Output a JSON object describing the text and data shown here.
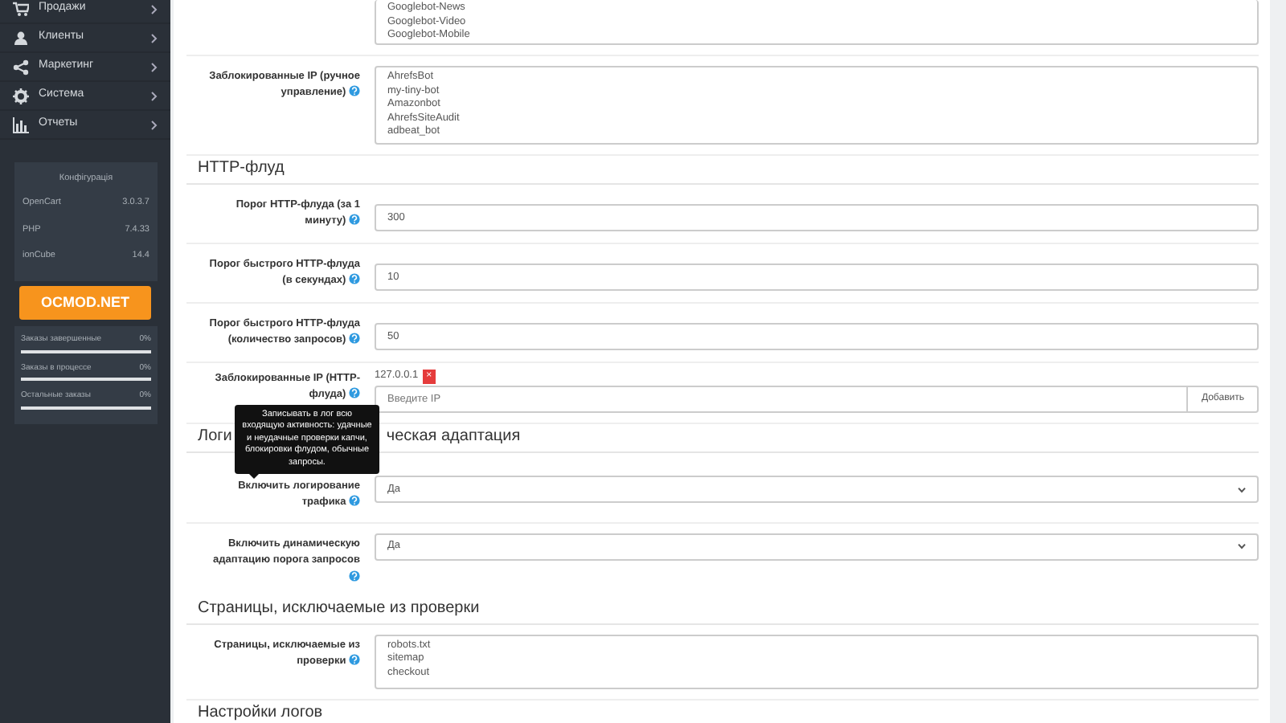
{
  "sidebar": {
    "menu": [
      {
        "kind": "cart",
        "label": "Продажи"
      },
      {
        "kind": "user",
        "label": "Клиенты"
      },
      {
        "kind": "share",
        "label": "Маркетинг"
      },
      {
        "kind": "gear",
        "label": "Система"
      },
      {
        "kind": "chart",
        "label": "Отчеты"
      }
    ],
    "config": {
      "title": "Конфігурація",
      "rows": [
        {
          "name": "OpenCart",
          "value": "3.0.3.7"
        },
        {
          "name": "PHP",
          "value": "7.4.33"
        },
        {
          "name": "ionCube",
          "value": "14.4"
        }
      ]
    },
    "brand_button": "OCMOD.NET",
    "order_stats": [
      {
        "label": "Заказы завершенные",
        "value": "0%",
        "level": 0
      },
      {
        "label": "Заказы в процессе",
        "value": "0%",
        "level": 0
      },
      {
        "label": "Остальные заказы",
        "value": "0%",
        "level": 0
      }
    ]
  },
  "form": {
    "items": [
      {
        "kind": "textarea",
        "lines": [
          "Googlebot-News",
          "Googlebot-Video",
          "Googlebot-Mobile"
        ]
      },
      {
        "kind": "textarea",
        "label": "Заблокированные IP (ручное управление)",
        "lines": [
          "AhrefsBot",
          "my-tiny-bot",
          "Amazonbot",
          "AhrefsSiteAudit",
          "adbeat_bot"
        ]
      },
      {
        "kind": "heading",
        "parts": [
          "HTTP-флуд"
        ]
      },
      {
        "kind": "input",
        "label": "Порог HTTP-флуда (за 1 минуту)",
        "value": "300"
      },
      {
        "kind": "input",
        "label": "Порог быстрого HTTP-флуда (в секундах)",
        "value": "10"
      },
      {
        "kind": "input",
        "label": "Порог быстрого HTTP-флуда (количество запросов)",
        "value": "50"
      },
      {
        "kind": "ip_list",
        "label": "Заблокированные IP (HTTP-флуда)",
        "ips": [
          {
            "ip": "127.0.0.1",
            "remove": "×"
          }
        ],
        "placeholder": "Введите IP",
        "button": "Добавить"
      },
      {
        "kind": "heading",
        "parts": [
          "Логи",
          "ческая адаптация"
        ]
      },
      {
        "kind": "select",
        "label": "Включить логирование трафика",
        "value": "Да",
        "tooltip": "Записывать в лог всю входящую активность: удачные и неудачные проверки капчи, блокировки флудом, обычные запросы."
      },
      {
        "kind": "select",
        "label": "Включить динамическую адаптацию порога запросов",
        "value": "Да"
      },
      {
        "kind": "heading",
        "parts": [
          "Страницы, исключаемые из проверки"
        ]
      },
      {
        "kind": "textarea",
        "label": "Страницы, исключаемые из проверки",
        "lines": [
          "robots.txt",
          "sitemap",
          "checkout"
        ]
      },
      {
        "kind": "heading",
        "parts": [
          "Настройки логов"
        ]
      }
    ]
  }
}
